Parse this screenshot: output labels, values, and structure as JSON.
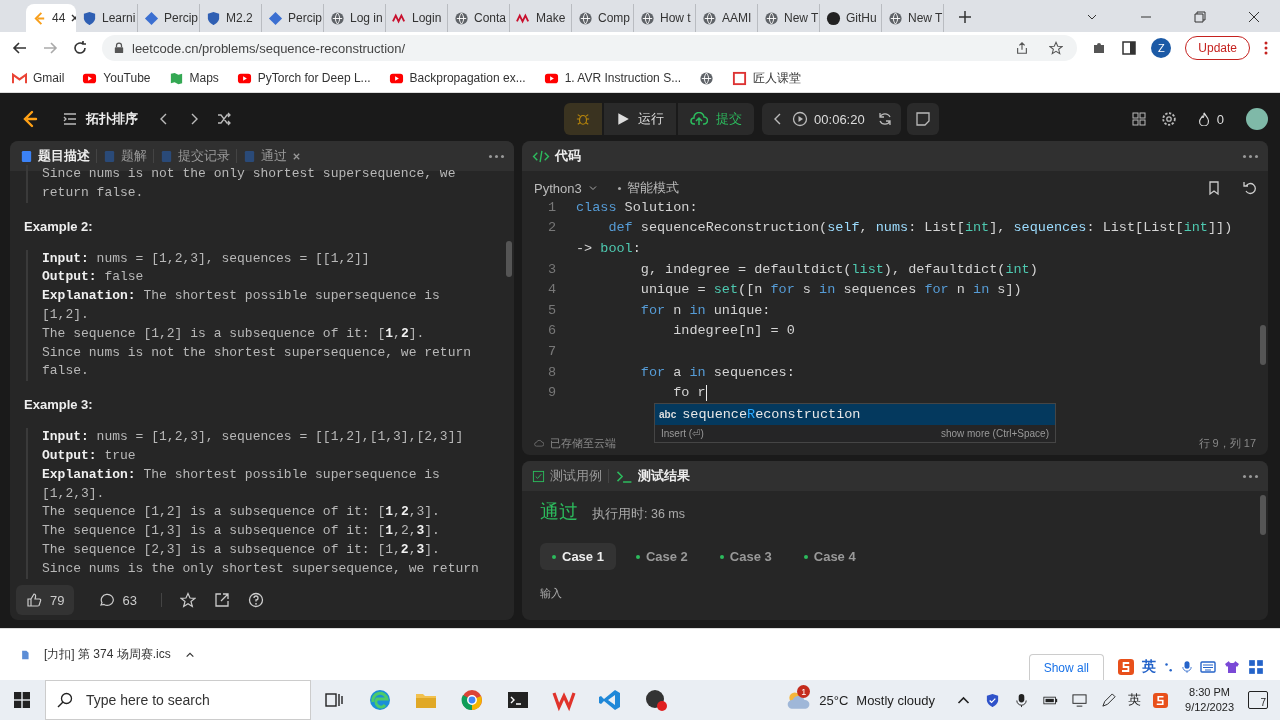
{
  "browser": {
    "tabs": [
      {
        "kind": "leetcode",
        "label": "44",
        "selected": true
      },
      {
        "kind": "shield",
        "label": "Learni",
        "selected": false
      },
      {
        "kind": "diamond",
        "label": "Percip",
        "selected": false
      },
      {
        "kind": "shield",
        "label": "M2.2",
        "selected": false
      },
      {
        "kind": "diamond",
        "label": "Percip",
        "selected": false
      },
      {
        "kind": "globe",
        "label": "Log in",
        "selected": false
      },
      {
        "kind": "aami",
        "label": "Login",
        "selected": false
      },
      {
        "kind": "globe",
        "label": "Conta",
        "selected": false
      },
      {
        "kind": "aami",
        "label": "Make",
        "selected": false
      },
      {
        "kind": "globe",
        "label": "Comp",
        "selected": false
      },
      {
        "kind": "globe",
        "label": "How t",
        "selected": false
      },
      {
        "kind": "globe",
        "label": "AAMI",
        "selected": false
      },
      {
        "kind": "globe",
        "label": "New T",
        "selected": false
      },
      {
        "kind": "github",
        "label": "GitHu",
        "selected": false
      },
      {
        "kind": "globe",
        "label": "New T",
        "selected": false
      }
    ],
    "url": "leetcode.cn/problems/sequence-reconstruction/",
    "profile": "Z",
    "update_button": "Update",
    "bookmarks": [
      {
        "kind": "gmail",
        "label": "Gmail"
      },
      {
        "kind": "youtube",
        "label": "YouTube"
      },
      {
        "kind": "maps",
        "label": "Maps"
      },
      {
        "kind": "youtube",
        "label": "PyTorch for Deep L..."
      },
      {
        "kind": "youtube",
        "label": "Backpropagation ex..."
      },
      {
        "kind": "youtube",
        "label": "1. AVR Instruction S..."
      },
      {
        "kind": "globe"
      },
      {
        "kind": "square",
        "label": "匠人课堂"
      }
    ]
  },
  "app": {
    "problem_title": "拓扑排序",
    "run_button": "运行",
    "submit_button": "提交",
    "timer": "00:06:20",
    "streak": "0"
  },
  "left_panel": {
    "tabs": [
      {
        "label": "题目描述",
        "selected": true,
        "closable": false
      },
      {
        "label": "题解",
        "selected": false,
        "closable": false
      },
      {
        "label": "提交记录",
        "selected": false,
        "closable": false
      },
      {
        "label": "通过",
        "selected": false,
        "closable": true
      }
    ],
    "content": [
      {
        "kind": "quote",
        "lines": [
          "Since nums is not the only shortest supersequence, we",
          "return false."
        ]
      },
      {
        "kind": "heading",
        "text": "Example 2:"
      },
      {
        "kind": "quote",
        "lines": [
          "**Input:** nums = [1,2,3], sequences = [[1,2]]",
          "**Output:** false",
          "**Explanation:** The shortest possible supersequence is",
          "[1,2].",
          "The sequence [1,2] is a subsequence of it: [**1**,**2**].",
          "Since nums is not the shortest supersequence, we return",
          "false."
        ]
      },
      {
        "kind": "heading",
        "text": "Example 3:"
      },
      {
        "kind": "quote",
        "lines": [
          "**Input:** nums = [1,2,3], sequences = [[1,2],[1,3],[2,3]]",
          "**Output:** true",
          "**Explanation:** The shortest possible supersequence is",
          "[1,2,3].",
          "The sequence [1,2] is a subsequence of it: [**1**,**2**,3].",
          "The sequence [1,3] is a subsequence of it: [**1**,2,**3**].",
          "The sequence [2,3] is a subsequence of it: [1,**2**,**3**].",
          "Since nums is the only shortest supersequence, we return"
        ]
      }
    ],
    "likes": "79",
    "comments": "63"
  },
  "code_panel": {
    "title": "代码",
    "language": "Python3",
    "mode": "智能模式",
    "lines": [
      {
        "number": "1",
        "cursor": false,
        "tokens": [
          {
            "kind": "keyword",
            "text": "class"
          },
          {
            "kind": "plain",
            "text": " Solution:"
          }
        ]
      },
      {
        "number": "2",
        "cursor": false,
        "tokens": [
          {
            "kind": "keyword",
            "text": "    def"
          },
          {
            "kind": "plain",
            "text": " sequenceReconstruction("
          },
          {
            "kind": "param",
            "text": "self"
          },
          {
            "kind": "plain",
            "text": ", "
          },
          {
            "kind": "param",
            "text": "nums"
          },
          {
            "kind": "plain",
            "text": ": List["
          },
          {
            "kind": "builtin",
            "text": "int"
          },
          {
            "kind": "plain",
            "text": "], "
          },
          {
            "kind": "param",
            "text": "sequences"
          },
          {
            "kind": "plain",
            "text": ": List[List["
          },
          {
            "kind": "builtin",
            "text": "int"
          },
          {
            "kind": "plain",
            "text": "]])"
          }
        ]
      },
      {
        "cursor": false,
        "tokens": [
          {
            "kind": "plain",
            "text": "-> "
          },
          {
            "kind": "builtin",
            "text": "bool"
          },
          {
            "kind": "plain",
            "text": ":"
          }
        ]
      },
      {
        "number": "3",
        "cursor": false,
        "tokens": [
          {
            "kind": "plain",
            "text": "        g, indegree = defaultdict("
          },
          {
            "kind": "builtin",
            "text": "list"
          },
          {
            "kind": "plain",
            "text": "), defaultdict("
          },
          {
            "kind": "builtin",
            "text": "int"
          },
          {
            "kind": "plain",
            "text": ")"
          }
        ]
      },
      {
        "number": "4",
        "cursor": false,
        "tokens": [
          {
            "kind": "plain",
            "text": "        unique = "
          },
          {
            "kind": "builtin",
            "text": "set"
          },
          {
            "kind": "plain",
            "text": "([n "
          },
          {
            "kind": "keyword",
            "text": "for"
          },
          {
            "kind": "plain",
            "text": " s "
          },
          {
            "kind": "keyword",
            "text": "in"
          },
          {
            "kind": "plain",
            "text": " sequences "
          },
          {
            "kind": "keyword",
            "text": "for"
          },
          {
            "kind": "plain",
            "text": " n "
          },
          {
            "kind": "keyword",
            "text": "in"
          },
          {
            "kind": "plain",
            "text": " s])"
          }
        ]
      },
      {
        "number": "5",
        "cursor": false,
        "tokens": [
          {
            "kind": "keyword",
            "text": "        for"
          },
          {
            "kind": "plain",
            "text": " n "
          },
          {
            "kind": "keyword",
            "text": "in"
          },
          {
            "kind": "plain",
            "text": " unique:"
          }
        ]
      },
      {
        "number": "6",
        "cursor": false,
        "tokens": [
          {
            "kind": "plain",
            "text": "            indegree[n] = 0"
          }
        ]
      },
      {
        "number": "7",
        "cursor": false
      },
      {
        "number": "8",
        "cursor": false,
        "tokens": [
          {
            "kind": "keyword",
            "text": "        for"
          },
          {
            "kind": "plain",
            "text": " a "
          },
          {
            "kind": "keyword",
            "text": "in"
          },
          {
            "kind": "plain",
            "text": " sequences:"
          }
        ]
      },
      {
        "number": "9",
        "cursor": true,
        "tokens": [
          {
            "kind": "plain",
            "text": "            fo r"
          }
        ]
      }
    ],
    "autocomplete": {
      "icon_text": "abc",
      "parts": [
        {
          "text": "sequence",
          "match": false
        },
        {
          "text": "R",
          "match": true
        },
        {
          "text": "econstruction",
          "match": false
        }
      ],
      "hint": "Insert (⏎)",
      "more": "show more (Ctrl+Space)"
    },
    "saved": "已存储至云端",
    "position": "行 9，列 17"
  },
  "result_panel": {
    "tabs": [
      {
        "label": "测试用例",
        "selected": false
      },
      {
        "label": "测试结果",
        "selected": true
      }
    ],
    "status": "通过",
    "runtime": "执行用时: 36 ms",
    "cases": [
      {
        "label": "Case 1",
        "selected": true
      },
      {
        "label": "Case 2",
        "selected": false
      },
      {
        "label": "Case 3",
        "selected": false
      },
      {
        "label": "Case 4",
        "selected": false
      }
    ],
    "input_label": "输入"
  },
  "download_bar": {
    "file": "[力扣] 第 374 场周赛.ics",
    "show_all": "Show all"
  },
  "ime": {
    "label": "英"
  },
  "taskbar": {
    "search_placeholder": "Type here to search",
    "apps": [
      {
        "kind": "taskview"
      },
      {
        "kind": "edge"
      },
      {
        "kind": "folder"
      },
      {
        "kind": "chrome"
      },
      {
        "kind": "terminal"
      },
      {
        "kind": "wps"
      },
      {
        "kind": "vscode"
      },
      {
        "kind": "obs"
      }
    ],
    "weather_badge": "1",
    "temperature": "25°C",
    "weather": "Mostly cloudy",
    "tray_label": "英",
    "time": "8:30 PM",
    "date": "9/12/2023",
    "notifications": "7"
  }
}
